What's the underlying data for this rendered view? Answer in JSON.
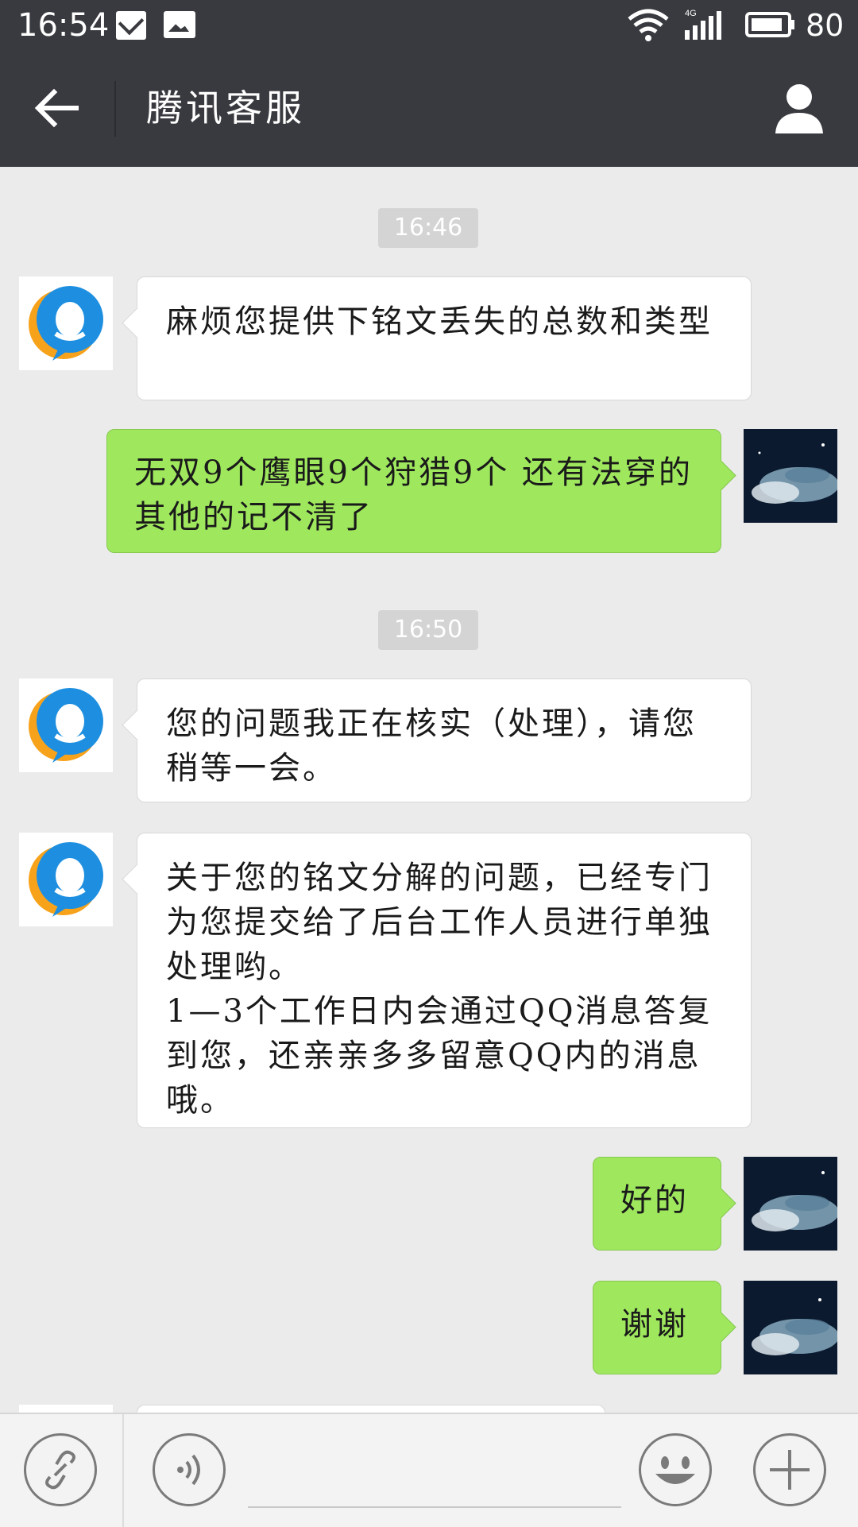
{
  "status_bar": {
    "time": "16:54",
    "network": "4G",
    "battery": "80",
    "icons": [
      "mail-icon",
      "picture-icon",
      "wifi-icon",
      "signal-icon",
      "battery-icon"
    ]
  },
  "header": {
    "title": "腾讯客服",
    "back_icon": "arrow-left-icon",
    "profile_icon": "person-icon"
  },
  "messages": [
    {
      "type": "time",
      "text": "16:46"
    },
    {
      "type": "received",
      "text": "麻烦您提供下铭文丢失的总数和类型"
    },
    {
      "type": "sent",
      "text": "无双9个鹰眼9个狩猎9个  还有法穿的  其他的记不清了"
    },
    {
      "type": "time",
      "text": "16:50"
    },
    {
      "type": "received",
      "text": "您的问题我正在核实（处理），请您稍等一会。"
    },
    {
      "type": "received",
      "text": "关于您的铭文分解的问题，已经专门为您提交给了后台工作人员进行单独处理哟。\n1—3个工作日内会通过QQ消息答复到您，还亲亲多多留意QQ内的消息哦。"
    },
    {
      "type": "sent",
      "text": "好的"
    },
    {
      "type": "sent",
      "text": "谢谢"
    }
  ],
  "input_bar": {
    "icons": [
      "link-icon",
      "voice-icon",
      "emoji-icon",
      "plus-icon"
    ],
    "input_value": ""
  },
  "colors": {
    "header_bg": "#393a3f",
    "chat_bg": "#ebebeb",
    "sent_bubble": "#9fe85e",
    "received_bubble": "#ffffff",
    "qq_blue": "#1e8fe0",
    "qq_orange": "#f7a21b"
  }
}
